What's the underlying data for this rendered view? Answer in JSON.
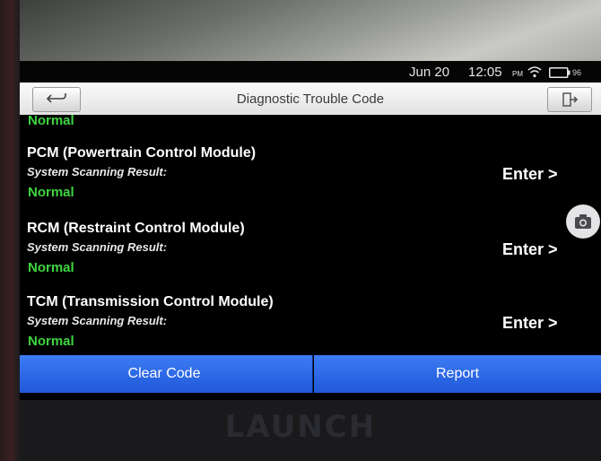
{
  "status_bar": {
    "date": "Jun 20",
    "time": "12:05",
    "ampm": "PM",
    "battery": "96"
  },
  "title_bar": {
    "title": "Diagnostic Trouble Code",
    "back_icon": "back-arrow-icon",
    "exit_icon": "exit-icon"
  },
  "previous_status": "Normal",
  "modules": [
    {
      "name": "PCM (Powertrain Control Module)",
      "label": "System Scanning Result:",
      "status": "Normal",
      "action": "Enter >"
    },
    {
      "name": "RCM (Restraint Control Module)",
      "label": "System Scanning Result:",
      "status": "Normal",
      "action": "Enter >"
    },
    {
      "name": "TCM (Transmission Control Module)",
      "label": "System Scanning Result:",
      "status": "Normal",
      "action": "Enter >"
    }
  ],
  "buttons": {
    "clear_code": "Clear Code",
    "report": "Report"
  },
  "brand": "LAUNCH",
  "colors": {
    "status_ok": "#3fd43f",
    "button_blue": "#2a66e8",
    "background": "#000000"
  }
}
